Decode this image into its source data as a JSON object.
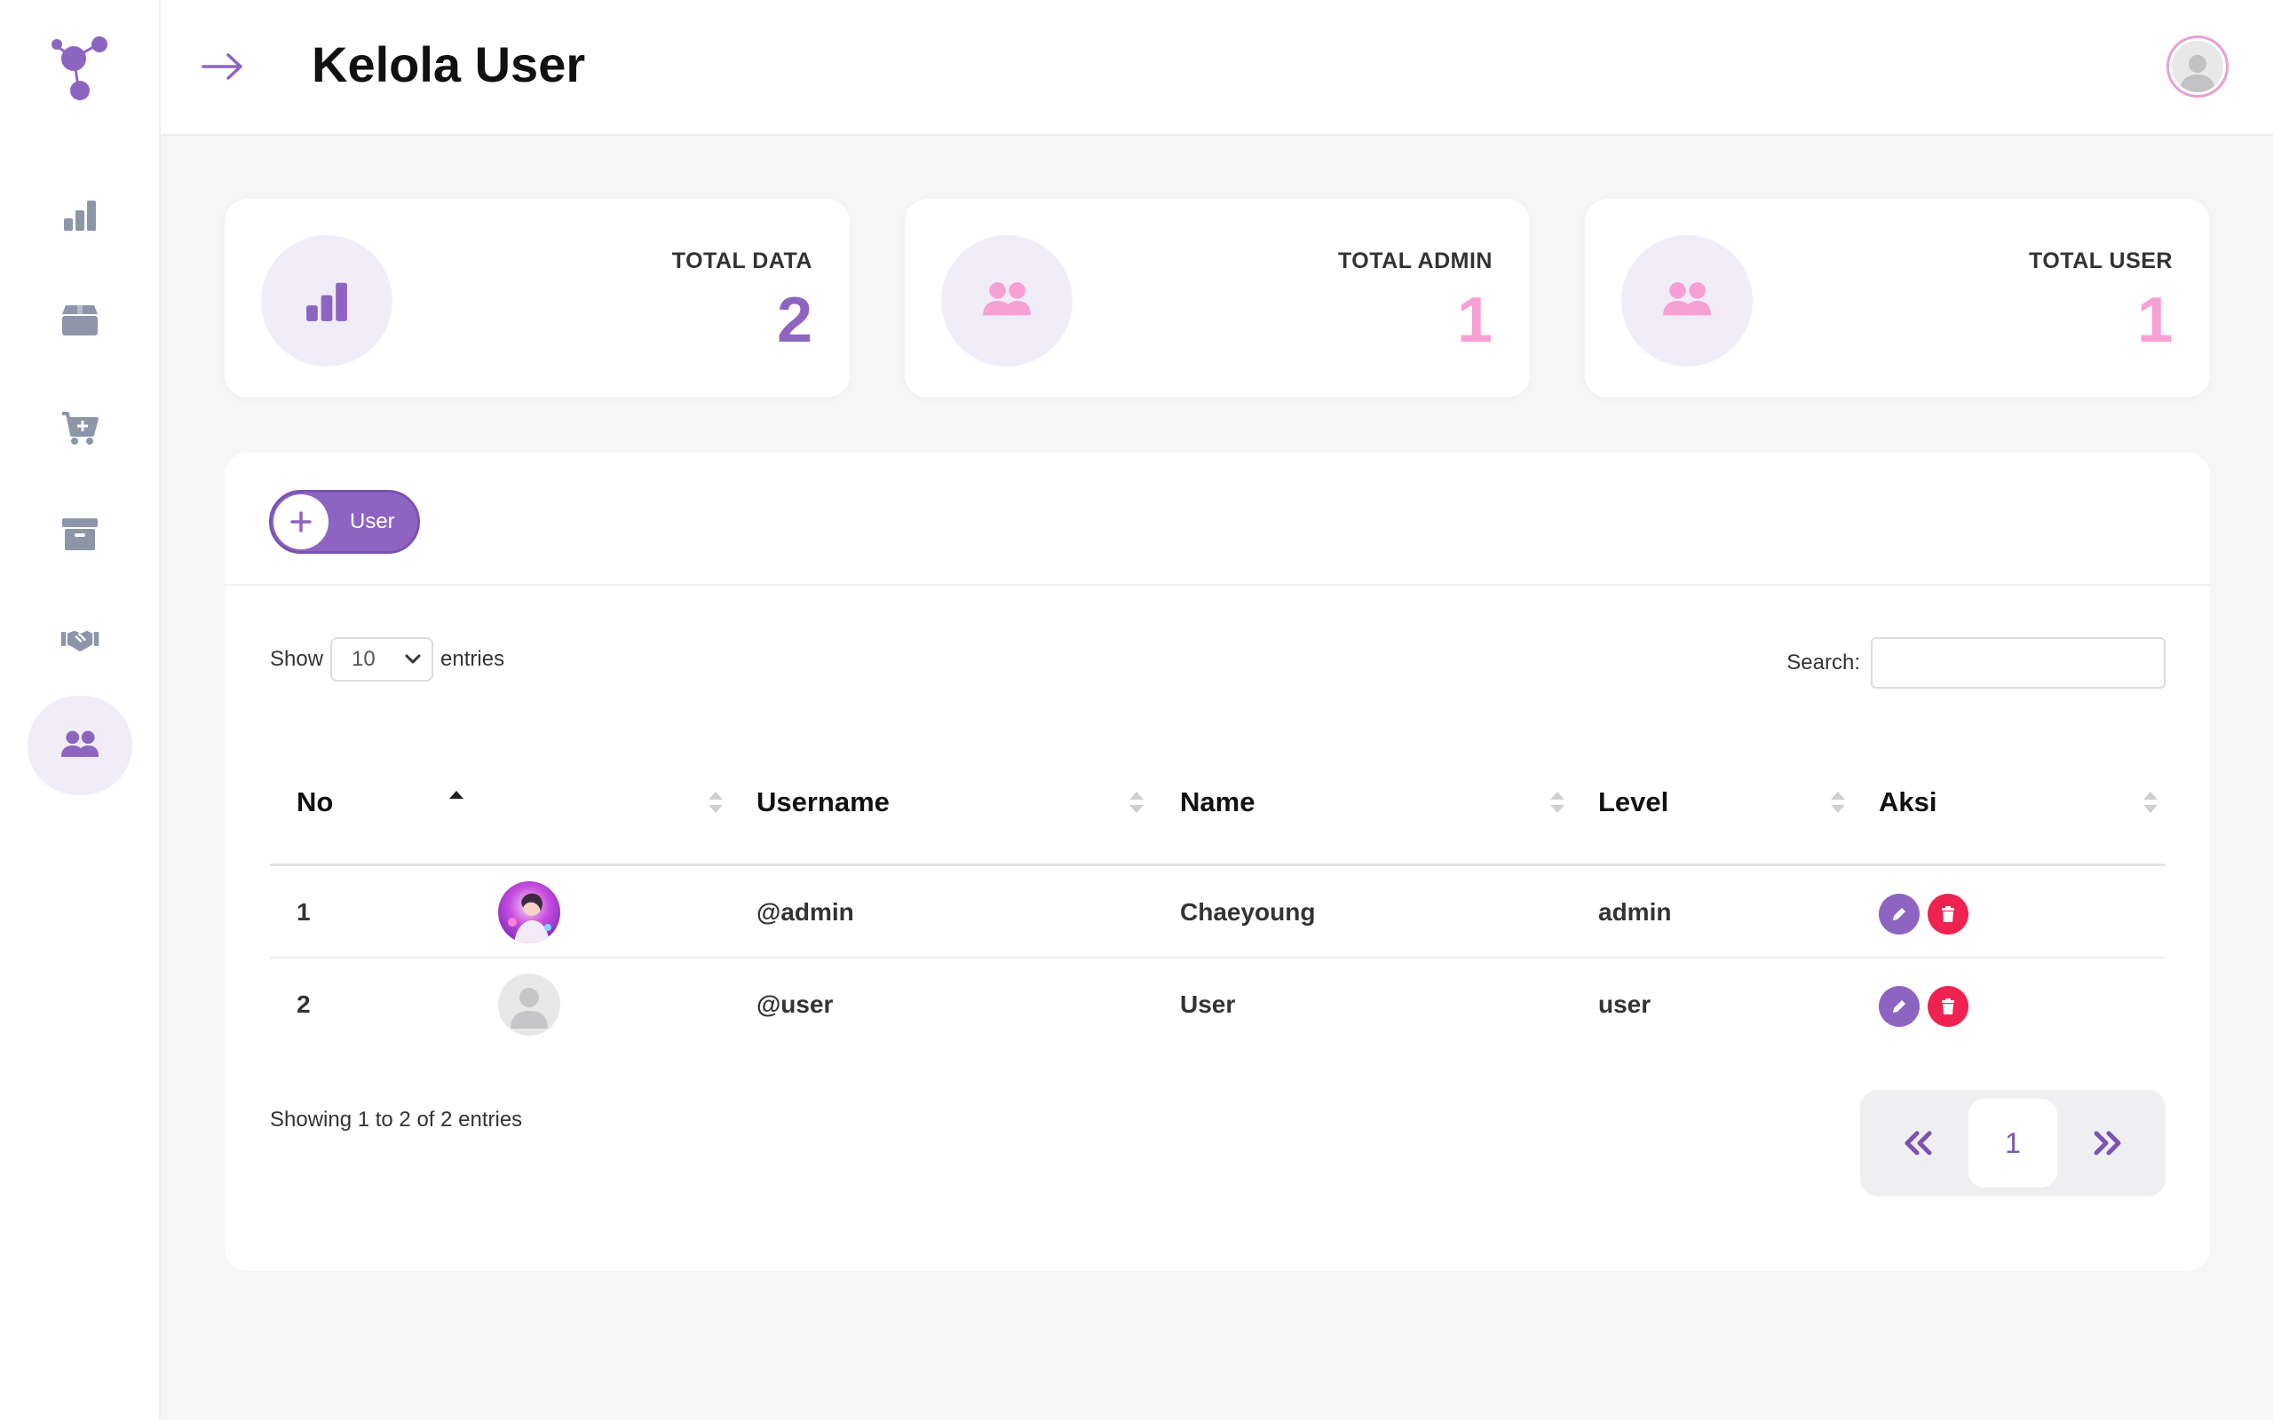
{
  "header": {
    "title": "Kelola User"
  },
  "sidebar": {
    "items": [
      {
        "icon": "bar-chart-icon",
        "active": false
      },
      {
        "icon": "box-icon",
        "active": false
      },
      {
        "icon": "cart-plus-icon",
        "active": false
      },
      {
        "icon": "archive-icon",
        "active": false
      },
      {
        "icon": "handshake-icon",
        "active": false
      },
      {
        "icon": "users-icon",
        "active": true
      }
    ]
  },
  "stats": [
    {
      "label": "TOTAL DATA",
      "value": "2",
      "icon": "bar-chart-icon",
      "color": "#8e64c2"
    },
    {
      "label": "TOTAL ADMIN",
      "value": "1",
      "icon": "users-icon",
      "color": "#f7a0d4"
    },
    {
      "label": "TOTAL USER",
      "value": "1",
      "icon": "users-icon",
      "color": "#f7a0d4"
    }
  ],
  "toolbar": {
    "add_label": "User"
  },
  "table_controls": {
    "show_label": "Show",
    "entries_value": "10",
    "entries_label": "entries",
    "search_label": "Search:",
    "search_value": ""
  },
  "table": {
    "headers": [
      "No",
      "",
      "Username",
      "Name",
      "Level",
      "Aksi"
    ],
    "rows": [
      {
        "no": "1",
        "username": "@admin",
        "name": "Chaeyoung",
        "level": "admin",
        "avatar": "photo"
      },
      {
        "no": "2",
        "username": "@user",
        "name": "User",
        "level": "user",
        "avatar": "placeholder"
      }
    ]
  },
  "footer": {
    "info": "Showing 1 to 2 of 2 entries",
    "current_page": "1"
  },
  "colors": {
    "accent": "#8e64c2",
    "pink": "#f7a0d4",
    "danger": "#f0224f",
    "icon_gray": "#8d96a8"
  }
}
